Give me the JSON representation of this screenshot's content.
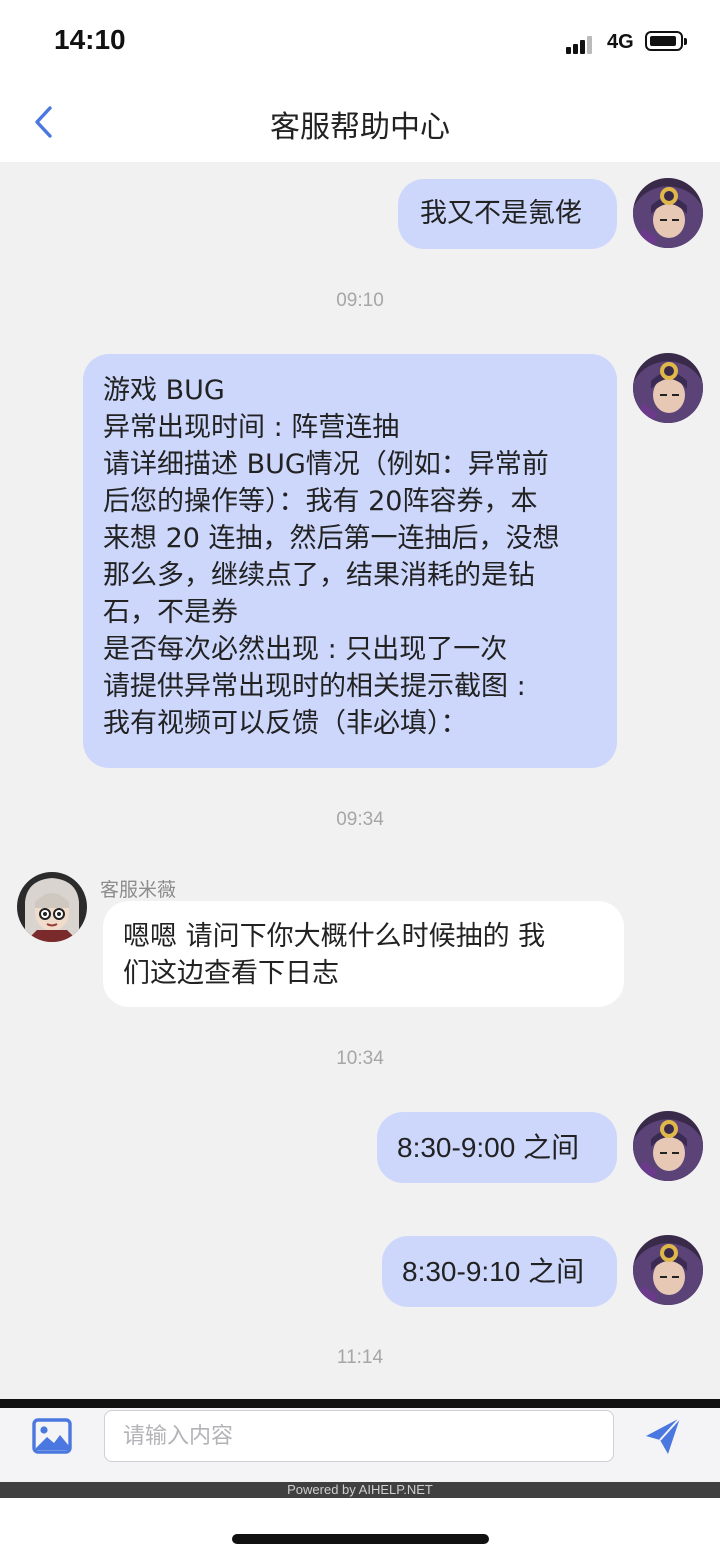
{
  "status_bar": {
    "time": "14:10",
    "network": "4G"
  },
  "header": {
    "title": "客服帮助中心",
    "back_icon": "chevron-left-icon"
  },
  "colors": {
    "accent": "#4a78e0",
    "user_bubble": "#cdd7fc",
    "agent_bubble": "#ffffff",
    "background": "#f1f1f2"
  },
  "messages": [
    {
      "sender": "user",
      "lines": [
        "我又不是氪佬"
      ]
    },
    {
      "type": "time",
      "text": "09:10"
    },
    {
      "sender": "user",
      "lines": [
        "游戏 BUG",
        "异常出现时间 : 阵营连抽",
        "请详细描述 BUG情况（例如：异常前",
        "后您的操作等）：我有 20阵容券，本",
        "来想 20 连抽，然后第一连抽后，没想",
        "那么多，继续点了，结果消耗的是钻",
        "石，不是券",
        "是否每次必然出现 : 只出现了一次",
        " 请提供异常出现时的相关提示截图 :",
        "我有视频可以反馈（非必填）："
      ]
    },
    {
      "type": "time",
      "text": "09:34"
    },
    {
      "sender": "agent",
      "name": "客服米薇",
      "lines": [
        "嗯嗯 请问下你大概什么时候抽的   我",
        "们这边查看下日志"
      ]
    },
    {
      "type": "time",
      "text": "10:34"
    },
    {
      "sender": "user",
      "lines": [
        "8:30-9:00 之间"
      ]
    },
    {
      "sender": "user",
      "lines": [
        "8:30-9:10 之间"
      ]
    },
    {
      "type": "time",
      "text": "11:14"
    }
  ],
  "input": {
    "placeholder": "请输入内容",
    "image_icon": "image-icon",
    "send_icon": "send-icon"
  },
  "footer": {
    "powered_by": "Powered by AIHELP.NET"
  }
}
